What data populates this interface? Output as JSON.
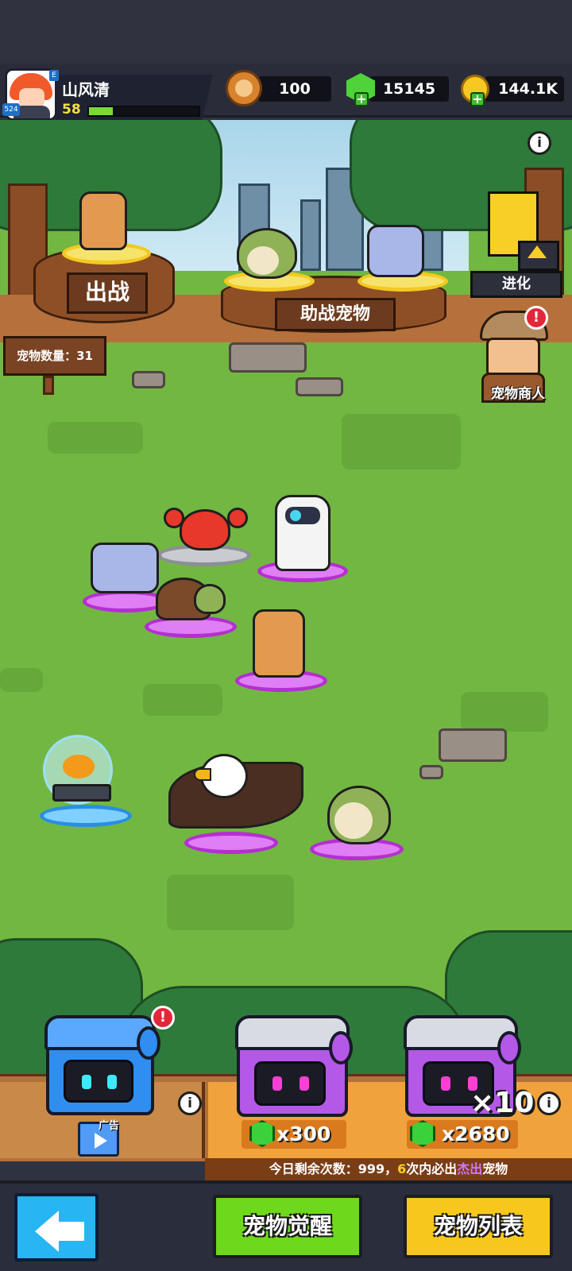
{
  "player": {
    "name": "山风清",
    "level": "58",
    "avatar_tag": "524",
    "xp_progress": 0.22
  },
  "resources": {
    "paw_tokens": "100",
    "gems": "15145",
    "gold": "144.1K"
  },
  "scene": {
    "battle_sign": "出战",
    "assist_sign": "助战宠物",
    "pet_count_label": "宠物数量：31",
    "evolve_label": "进化",
    "merchant_label": "宠物商人"
  },
  "gacha": {
    "free_ad_label": "广告",
    "single_price": "x300",
    "ten_pull_multiplier": "×10",
    "ten_pull_price": "x2680",
    "footer_prefix": "今日剩余次数：999，",
    "footer_count": "6",
    "footer_mid": "次内必出",
    "footer_rarity": "杰出",
    "footer_suffix": "宠物"
  },
  "nav": {
    "awaken_label": "宠物觉醒",
    "list_label": "宠物列表"
  },
  "colors": {
    "grass": "#72b741",
    "accent_green": "#6ed81c",
    "accent_yellow": "#f7c71d",
    "rarity_purple": "#b42fd1",
    "rarity_gold": "#f4c920",
    "alert_red": "#e32639"
  }
}
